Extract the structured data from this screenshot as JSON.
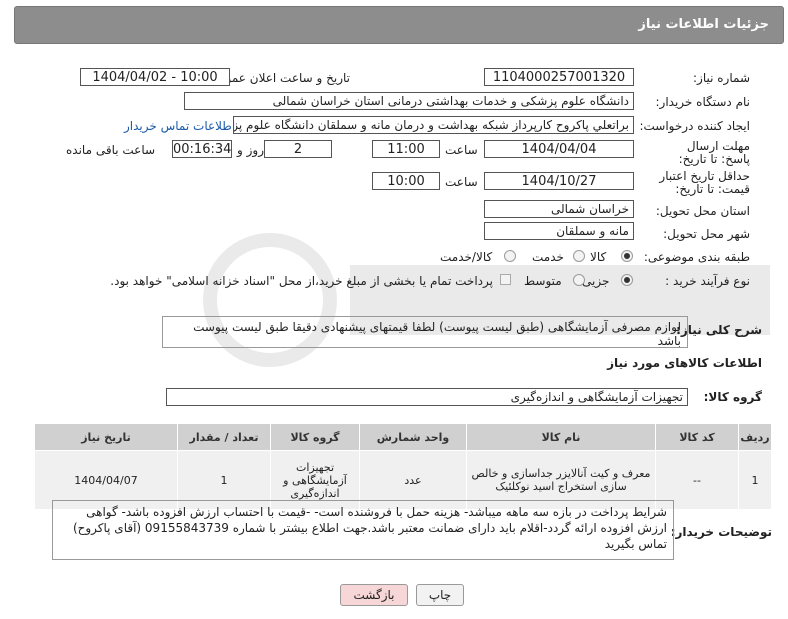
{
  "header": {
    "title": "جزئیات اطلاعات نیاز"
  },
  "fields": {
    "need_number_label": "شماره نیاز:",
    "need_number": "1104000257001320",
    "announce_label": "تاریخ و ساعت اعلان عمومی:",
    "announce_value": "1404/04/02 - 10:00",
    "buyer_label": "نام دستگاه خریدار:",
    "buyer_value": "دانشگاه علوم پزشکی و خدمات بهداشتی درمانی استان خراسان شمالی",
    "creator_label": "ایجاد کننده درخواست:",
    "creator_value": "براتعلي پاكروح كارپرداز شبكه بهداشت و درمان مانه و سملقان دانشگاه علوم پزشكي",
    "contact_link": "اطلاعات تماس خریدار",
    "deadline_label": "مهلت ارسال پاسخ: تا تاریخ:",
    "deadline_date": "1404/04/04",
    "time_label": "ساعت",
    "deadline_time": "11:00",
    "days_value": "2",
    "days_label": "روز و",
    "remaining_value": "00:16:34",
    "remaining_label": "ساعت باقی مانده",
    "validity_label": "حداقل تاریخ اعتبار قیمت: تا تاریخ:",
    "validity_date": "1404/10/27",
    "validity_time": "10:00",
    "province_label": "استان محل تحویل:",
    "province_value": "خراسان شمالی",
    "city_label": "شهر محل تحویل:",
    "city_value": "مانه و سملقان",
    "category_label": "طبقه بندی موضوعی:",
    "category_options": [
      "کالا",
      "خدمت",
      "کالا/خدمت"
    ],
    "process_label": "نوع فرآیند خرید :",
    "process_options": [
      "جزیی",
      "متوسط"
    ],
    "payment_note": "پرداخت تمام یا بخشی از مبلغ خرید،از محل \"اسناد خزانه اسلامی\" خواهد بود.",
    "description_label": "شرح کلی نیاز:",
    "description_value": "لوازم مصرفی آزمایشگاهی (طبق لیست پیوست) لطفا قیمتهای پیشنهادی دقیقا طبق لیست پیوست باشد",
    "goods_info_title": "اطلاعات کالاهای مورد نیاز",
    "goods_group_label": "گروه کالا:",
    "goods_group_value": "تجهیزات آزمایشگاهی و اندازه‌گیری"
  },
  "table": {
    "headers": [
      "ردیف",
      "کد کالا",
      "نام کالا",
      "واحد شمارش",
      "گروه کالا",
      "تعداد / مقدار",
      "تاریخ نیاز"
    ],
    "rows": [
      [
        "1",
        "--",
        "معرف و کیت آنالایزر جداسازی و خالص سازی استخراج اسید نوکلئیک",
        "عدد",
        "تجهیزات آزمایشگاهی و اندازه‌گیری",
        "1",
        "1404/04/07"
      ]
    ]
  },
  "notes": {
    "label": "توضیحات خریدار:",
    "value": "شرایط پرداخت در بازه سه ماهه میباشد- هزینه حمل با فروشنده است- -قیمت با احتساب ارزش افزوده  باشد- گواهی ارزش افزوده ارائه گردد-اقلام باید دارای ضمانت معتبر باشد.جهت اطلاع بیشتر با شماره 09155843739 (آقای پاکروح) تماس بگیرید"
  },
  "buttons": {
    "print": "چاپ",
    "back": "بازگشت"
  },
  "colors": {
    "header_bg": "#8d8d8d",
    "link": "#1a5aa8",
    "back_button_bg": "#f6d6d6"
  }
}
